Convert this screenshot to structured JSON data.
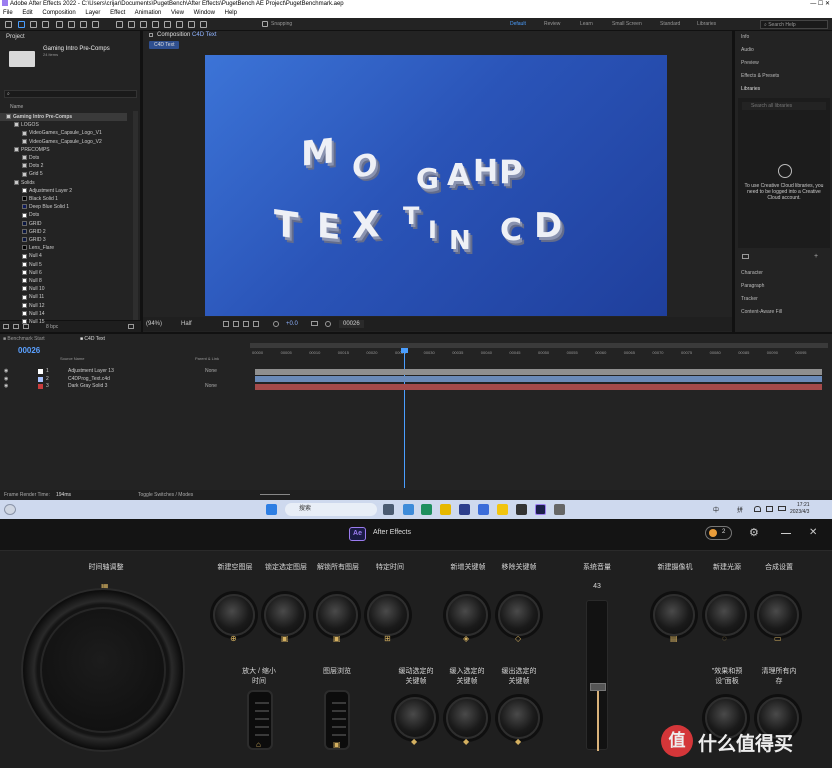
{
  "window": {
    "title": "Adobe After Effects 2022 - C:\\Users\\crijar\\Documents\\PugetBench\\After Effects\\PugetBench AE Project\\PugetBenchmark.aep",
    "controls": "— ☐ ✕"
  },
  "menu": [
    "File",
    "Edit",
    "Composition",
    "Layer",
    "Effect",
    "Animation",
    "View",
    "Window",
    "Help"
  ],
  "toolbar": {
    "snapping": "Snapping",
    "workspaces": [
      "Default",
      "Review",
      "Learn",
      "Small Screen",
      "Standard",
      "Libraries"
    ],
    "search_placeholder": "Search Help"
  },
  "project": {
    "tab": "Project",
    "comp_name": "Gaming Intro Pre-Comps",
    "comp_sub": "24 items",
    "col_name": "Name",
    "items": [
      {
        "label": "Gaming Intro Pre-Comps",
        "indent": 0,
        "color": "#c8c8c8",
        "bold": true
      },
      {
        "label": "LOGOS",
        "indent": 1,
        "color": "#c8c8c8"
      },
      {
        "label": "VideoGames_Capsule_Logo_V1",
        "indent": 2,
        "color": "#c8c8c8"
      },
      {
        "label": "VideoGames_Capsule_Logo_V2",
        "indent": 2,
        "color": "#c8c8c8"
      },
      {
        "label": "PRECOMPS",
        "indent": 1,
        "color": "#c8c8c8"
      },
      {
        "label": "Dots",
        "indent": 2,
        "color": "#c8c8c8"
      },
      {
        "label": "Dots 2",
        "indent": 2,
        "color": "#c8c8c8"
      },
      {
        "label": "Grid 5",
        "indent": 2,
        "color": "#c8c8c8"
      },
      {
        "label": "Solids",
        "indent": 1,
        "color": "#c8c8c8"
      },
      {
        "label": "Adjustment Layer 2",
        "indent": 2,
        "color": "#ffffff"
      },
      {
        "label": "Black Solid 1",
        "indent": 2,
        "color": "#000000"
      },
      {
        "label": "Deep Blue Solid 1",
        "indent": 2,
        "color": "#0d1a5c"
      },
      {
        "label": "Dots",
        "indent": 2,
        "color": "#ffffff"
      },
      {
        "label": "GRID",
        "indent": 2,
        "color": "#0a1640"
      },
      {
        "label": "GRID 2",
        "indent": 2,
        "color": "#0a1640"
      },
      {
        "label": "GRID 3",
        "indent": 2,
        "color": "#0a1640"
      },
      {
        "label": "Lens_Flare",
        "indent": 2,
        "color": "#000000"
      },
      {
        "label": "Null 4",
        "indent": 2,
        "color": "#ffffff"
      },
      {
        "label": "Null 5",
        "indent": 2,
        "color": "#ffffff"
      },
      {
        "label": "Null 6",
        "indent": 2,
        "color": "#ffffff"
      },
      {
        "label": "Null 8",
        "indent": 2,
        "color": "#ffffff"
      },
      {
        "label": "Null 10",
        "indent": 2,
        "color": "#ffffff"
      },
      {
        "label": "Null 11",
        "indent": 2,
        "color": "#ffffff"
      },
      {
        "label": "Null 12",
        "indent": 2,
        "color": "#ffffff"
      },
      {
        "label": "Null 14",
        "indent": 2,
        "color": "#ffffff"
      },
      {
        "label": "Null 15",
        "indent": 2,
        "color": "#ffffff"
      }
    ],
    "bpc": "8 bpc"
  },
  "composition": {
    "tab": "Composition",
    "tab_name": "C4D Text",
    "crumb": "C4D Text",
    "letters": [
      "M",
      "O",
      "G",
      "A",
      "H",
      "P",
      "T",
      "E",
      "X",
      "T",
      "I",
      "N",
      "C",
      "D"
    ],
    "zoom": "(94%)",
    "quality": "Half",
    "exposure": "+0.0",
    "timecode": "00026"
  },
  "right_panels": {
    "items": [
      "Info",
      "Audio",
      "Preview",
      "Effects & Presets",
      "Libraries"
    ],
    "lib_search": "Search all libraries",
    "cc_message": "To use Creative Cloud libraries, you need to be logged into a Creative Cloud account.",
    "lower": [
      "Character",
      "Paragraph",
      "Tracker",
      "Content-Aware Fill"
    ]
  },
  "timeline": {
    "tabs": [
      "Benchmark Start",
      "C4D Text"
    ],
    "timecode": "00026",
    "col_source": "Source Name",
    "col_parent": "Parent & Link",
    "ruler": [
      "00000",
      "00005",
      "00010",
      "00015",
      "00020",
      "00025",
      "00030",
      "00035",
      "00040",
      "00045",
      "00050",
      "00055",
      "00060",
      "00065",
      "00070",
      "00075",
      "00080",
      "00085",
      "00090",
      "00095"
    ],
    "layers": [
      {
        "num": "1",
        "name": "Adjustment Layer 13",
        "parent": "None",
        "color": "#ffffff"
      },
      {
        "num": "2",
        "name": "C4DProg_Text.c4d",
        "parent": "",
        "color": "#a9c3ff"
      },
      {
        "num": "3",
        "name": "Dark Gray Solid 3",
        "parent": "None",
        "color": "#c83c3c"
      }
    ],
    "render_time_label": "Frame Render Time:",
    "render_time": "194ms",
    "toggle": "Toggle Switches / Modes"
  },
  "taskbar": {
    "search": "搜索",
    "time": "17:21",
    "date": "2023/4/3",
    "lang": "中",
    "ime": "拼"
  },
  "console": {
    "app": "After Effects",
    "badge": "2",
    "sections": {
      "timeline_dial": "时间轴调整",
      "new_layer": "新建空图层",
      "lock_layer": "锁定选定图层",
      "unlock_all": "解锁所有图层",
      "specific_time": "特定时间",
      "add_keyframe": "新增关键帧",
      "remove_keyframe": "移除关键帧",
      "sys_volume": "系统音量",
      "volume": "43",
      "new_camera": "新建摄像机",
      "new_light": "新建光源",
      "comp_settings": "合成设置",
      "zoom": "放大 / 缩小\n时间",
      "layer_browse": "图层浏览",
      "ease_selected": "缓动选定的\n关键帧",
      "ease_in": "缓入选定的\n关键帧",
      "ease_out": "缓出选定的\n关键帧",
      "effects_presets": "\"效果和预\n设\"面板",
      "clear_all": "清理所有内\n存"
    }
  },
  "watermark": "值 什么值得买"
}
